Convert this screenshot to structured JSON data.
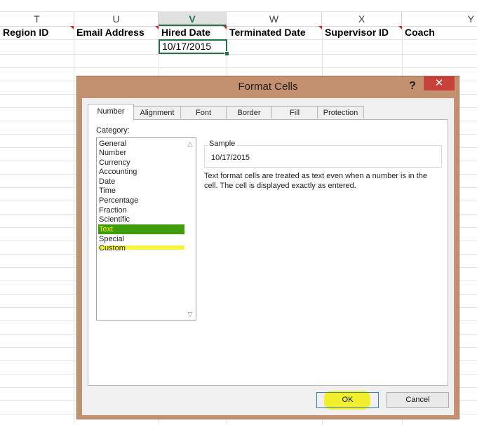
{
  "sheet": {
    "columns": [
      "T",
      "U",
      "V",
      "W",
      "X",
      "Y"
    ],
    "active_column": "V",
    "headers": [
      "Region ID",
      "Email Address",
      "Hired Date",
      "Terminated Date",
      "Supervisor ID",
      "Coach"
    ],
    "selected_cell_value": "10/17/2015"
  },
  "dialog": {
    "title": "Format Cells",
    "help": "?",
    "close": "✕",
    "tabs": [
      "Number",
      "Alignment",
      "Font",
      "Border",
      "Fill",
      "Protection"
    ],
    "active_tab": "Number",
    "category_label": "Category:",
    "categories": [
      "General",
      "Number",
      "Currency",
      "Accounting",
      "Date",
      "Time",
      "Percentage",
      "Fraction",
      "Scientific",
      "Text",
      "Special",
      "Custom"
    ],
    "selected_category": "Text",
    "sample_label": "Sample",
    "sample_value": "10/17/2015",
    "description": "Text format cells are treated as text even when a number is in the cell. The cell is displayed exactly as entered.",
    "ok_label": "OK",
    "cancel_label": "Cancel",
    "colors": {
      "frame": "#c49170",
      "close": "#c7403a",
      "selection": "#3e9c0d",
      "highlighter": "#f5f21a",
      "excel_green": "#217346"
    }
  }
}
